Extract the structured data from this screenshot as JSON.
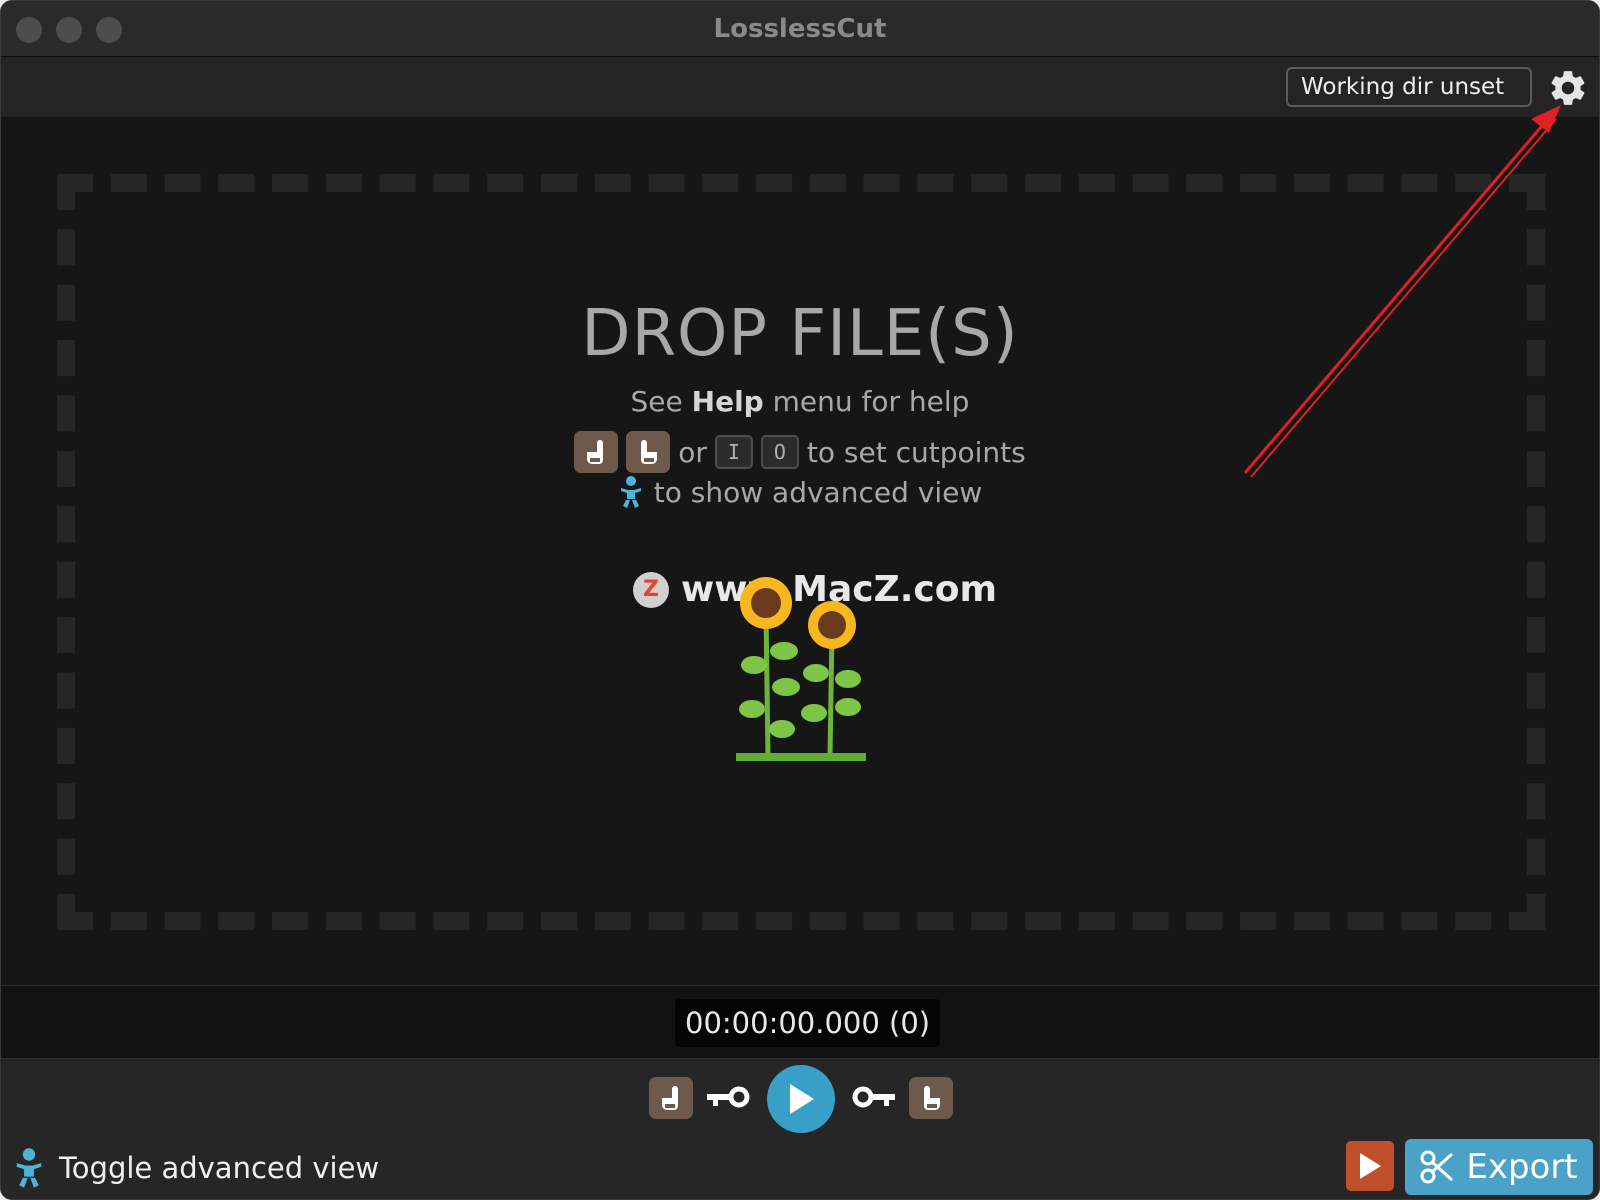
{
  "window": {
    "title": "LosslessCut"
  },
  "topbar": {
    "working_dir_label": "Working dir unset"
  },
  "dropzone": {
    "title": "DROP FILE(S)",
    "help_prefix": "See ",
    "help_bold": "Help",
    "help_suffix": " menu for help",
    "cut_or": "or",
    "key_in": "I",
    "key_out": "O",
    "cut_suffix": "to set cutpoints",
    "advanced_hint": "to show advanced view"
  },
  "watermark": {
    "logo_letter": "Z",
    "text": "www.MacZ.com"
  },
  "timeline": {
    "current_time": "00:00:00.000 (0)"
  },
  "bottom": {
    "toggle_advanced_label": "Toggle advanced view",
    "export_label": "Export"
  },
  "colors": {
    "accent": "#3a9fc6",
    "export": "#4aa3c7",
    "hand_button": "#6e5a4d",
    "annotation_arrow": "#e01f26"
  },
  "icons": {
    "settings": "gear-icon",
    "set_start": "hand-pointing-left-icon",
    "set_end": "hand-pointing-right-icon",
    "play": "play-icon",
    "keyframe_prev": "key-left-icon",
    "keyframe_next": "key-right-icon",
    "advanced_view": "baby-icon",
    "export": "scissors-icon"
  }
}
